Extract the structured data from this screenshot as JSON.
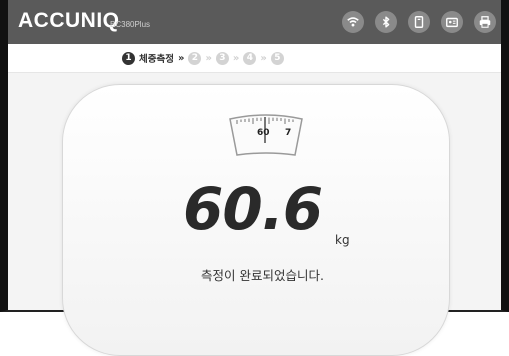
{
  "app": {
    "brand": "ACCUNIQ",
    "model": "BC380Plus"
  },
  "toolbar_icons": [
    "wifi-icon",
    "bluetooth-icon",
    "device-icon",
    "id-card-icon",
    "printer-icon"
  ],
  "steps": {
    "active": {
      "number": "1",
      "label": "체중측정"
    },
    "separator": "»",
    "inactive_numbers": [
      "2",
      "3",
      "4",
      "5"
    ]
  },
  "scale": {
    "dial_labels": [
      "60",
      "7"
    ],
    "weight_value": "60.6",
    "unit": "kg",
    "status_message": "측정이 완료되었습니다."
  },
  "colors": {
    "topbar": "#5a5a5a",
    "icon_bg": "#8a8a8a",
    "step_active": "#333333",
    "step_inactive": "#d3d3d3"
  }
}
